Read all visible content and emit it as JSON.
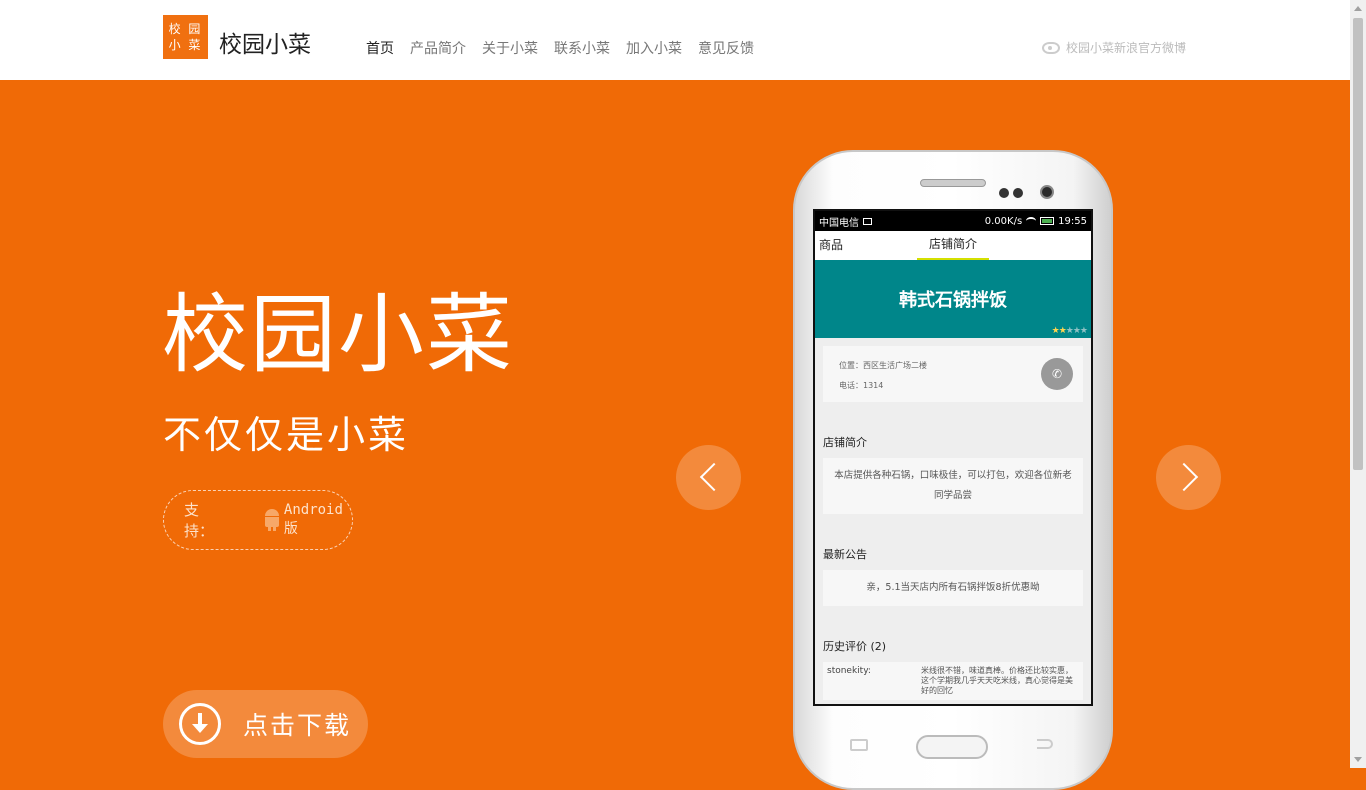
{
  "header": {
    "logo_line1": "校 园",
    "logo_line2": "小 菜",
    "brand": "校园小菜",
    "nav": [
      {
        "label": "首页",
        "active": true
      },
      {
        "label": "产品简介",
        "active": false
      },
      {
        "label": "关于小菜",
        "active": false
      },
      {
        "label": "联系小菜",
        "active": false
      },
      {
        "label": "加入小菜",
        "active": false
      },
      {
        "label": "意见反馈",
        "active": false
      }
    ],
    "weibo_link": "校园小菜新浪官方微博"
  },
  "hero": {
    "title": "校园小菜",
    "subtitle": "不仅仅是小菜",
    "support_label": "支持：",
    "support_platform": "Android版",
    "download_label": "点击下载"
  },
  "phone_screen": {
    "status": {
      "carrier": "中国电信",
      "speed": "0.00K/s",
      "time": "19:55"
    },
    "tabs": [
      "商品",
      "店铺简介"
    ],
    "shop_name": "韩式石锅拌饭",
    "location": "位置：西区生活广场二楼",
    "phone": "电话：1314",
    "intro_title": "店铺简介",
    "intro_text": "本店提供各种石锅，口味极佳，可以打包，欢迎各位新老同学品尝",
    "notice_title": "最新公告",
    "notice_text": "亲，5.1当天店内所有石锅拌饭8折优惠呦",
    "reviews_title": "历史评价 (2)",
    "review": {
      "user": "stonekity:",
      "text": "米线很不错，味道真棒。价格还比较实惠，这个学期我几乎天天吃米线，真心觉得是美好的回忆"
    }
  },
  "colors": {
    "accent": "#f06a06",
    "shop_banner": "#00868a"
  }
}
